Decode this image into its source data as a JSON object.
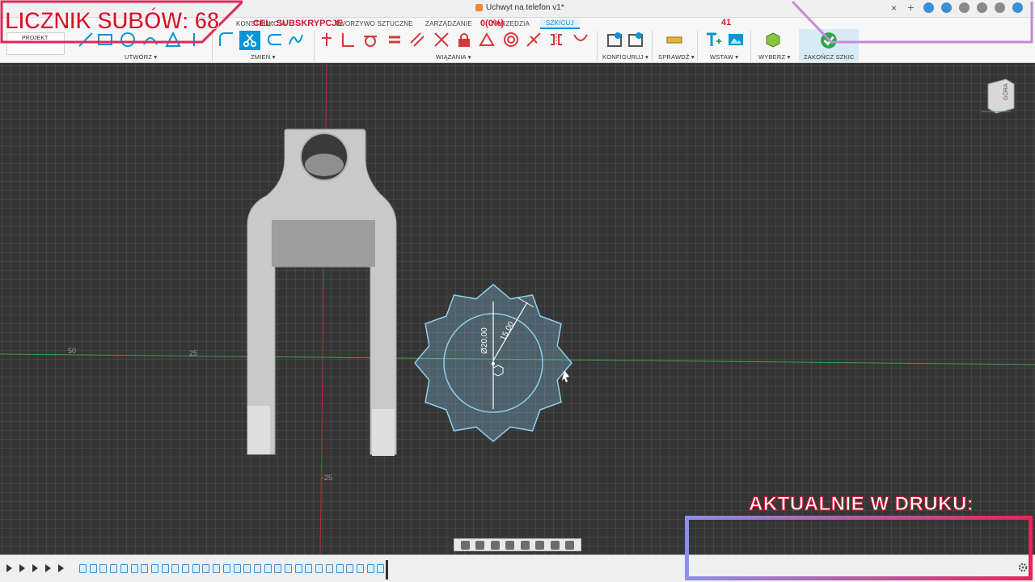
{
  "window": {
    "doc_title": "Uchwyt na telefon v1*",
    "close_label": "×"
  },
  "ribbon": {
    "tabs": [
      {
        "label": "KONSTRUKCJA"
      },
      {
        "label": "TWORZYWO SZTUCZNE"
      },
      {
        "label": "ZARZĄDZANIE"
      },
      {
        "label": "NARZĘDZIA"
      },
      {
        "label": "SZKICUJ"
      }
    ],
    "project_label": "PROJEKT",
    "groups": {
      "create": "UTWÓRZ ▾",
      "modify": "ZMIEŃ ▾",
      "constraints": "WIĄZANIA ▾",
      "configure": "KONFIGURUJ ▾",
      "inspect": "SPRAWDŹ ▾",
      "insert": "WSTAW ▾",
      "select": "WYBERZ ▾",
      "finish": "ZAKOŃCZ SZKIC ▾"
    }
  },
  "viewport": {
    "axis_labels": [
      "50",
      "25",
      "-25"
    ],
    "dims": {
      "diameter": "Ø20.00",
      "radius": "15.00"
    },
    "viewcube_label": "GÓRA"
  },
  "overlay": {
    "sub_counter": "LICZNIK SUBÓW: 68",
    "goal_label": "CEL: SUBSKRYPCJE",
    "goal_pct": "0(0%)",
    "goal_num": "41",
    "print_title": "AKTUALNIE W DRUKU:"
  },
  "colors": {
    "accent": "#0696d7",
    "overlay_red": "#d9152c",
    "sketch_line": "#8fd0ef"
  }
}
